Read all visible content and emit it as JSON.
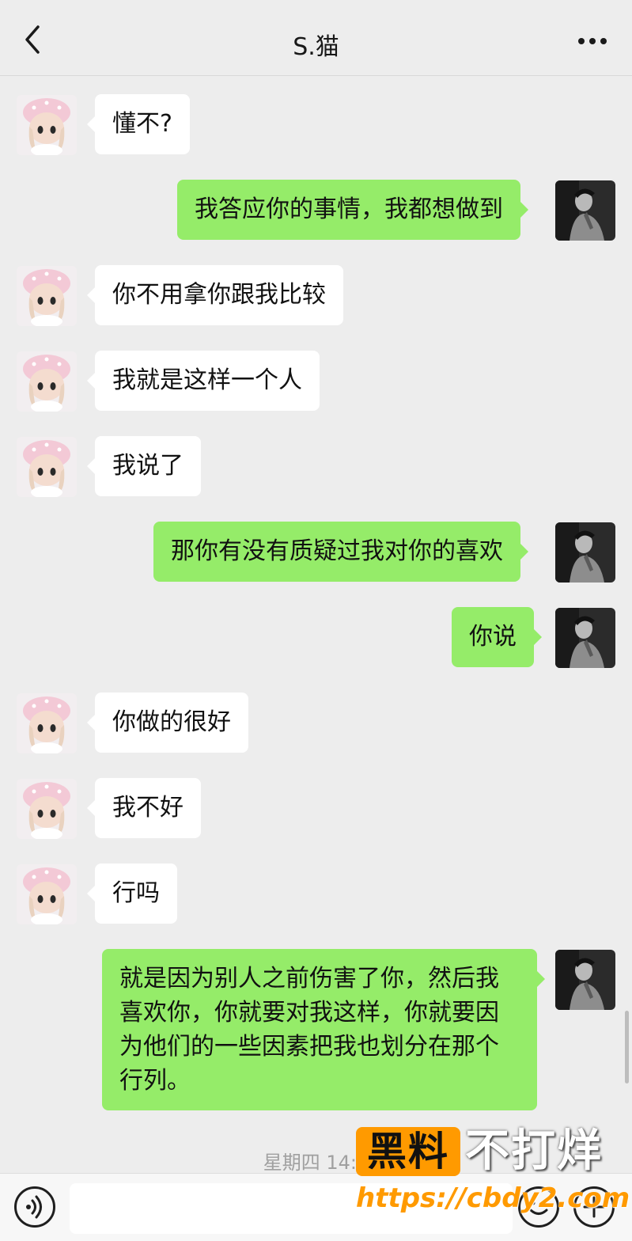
{
  "header": {
    "title": "S.猫",
    "back_icon": "chevron-left-icon",
    "more_icon": "more-dots-icon"
  },
  "messages": [
    {
      "side": "left",
      "text": "懂不?"
    },
    {
      "side": "right",
      "text": "我答应你的事情，我都想做到"
    },
    {
      "side": "left",
      "text": "你不用拿你跟我比较"
    },
    {
      "side": "left",
      "text": "我就是这样一个人"
    },
    {
      "side": "left",
      "text": "我说了"
    },
    {
      "side": "right",
      "text": "那你有没有质疑过我对你的喜欢"
    },
    {
      "side": "right",
      "text": "你说"
    },
    {
      "side": "left",
      "text": "你做的很好"
    },
    {
      "side": "left",
      "text": "我不好"
    },
    {
      "side": "left",
      "text": "行吗"
    },
    {
      "side": "right",
      "text": "就是因为别人之前伤害了你，然后我喜欢你，你就要对我这样，你就要因为他们的一些因素把我也划分在那个行列。"
    }
  ],
  "timestamp": "星期四 14:2",
  "input_bar": {
    "voice_icon": "voice-icon",
    "emoji_icon": "emoji-icon",
    "plus_icon": "plus-icon"
  },
  "watermark": {
    "badge": "黑料",
    "text": "不打烊",
    "url": "https://cbdy2.com"
  },
  "colors": {
    "background": "#ededed",
    "sent_bubble": "#95ec69",
    "received_bubble": "#ffffff",
    "watermark_orange": "#ff9a00"
  }
}
